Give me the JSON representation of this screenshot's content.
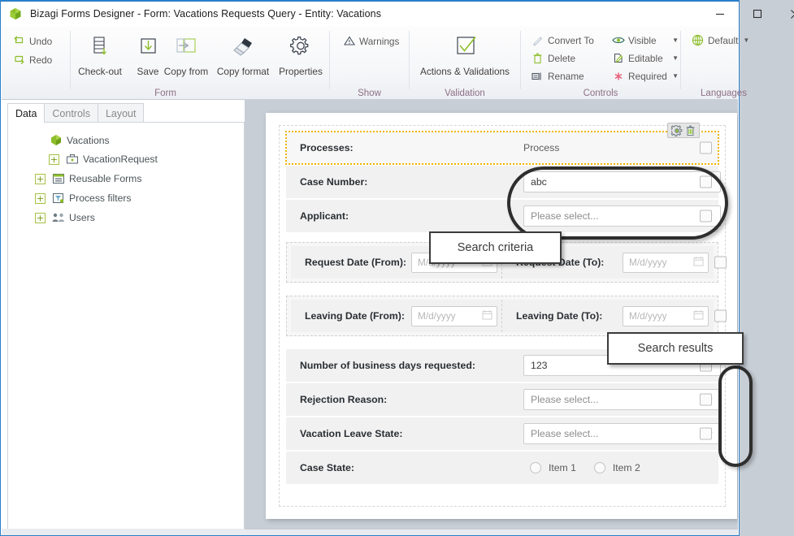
{
  "window": {
    "title": "Bizagi Forms Designer  - Form: Vacations Requests Query - Entity:  Vacations",
    "minimize_label": "Minimize",
    "maximize_label": "Maximize",
    "close_label": "Close",
    "app_icon": "bizagi-cube-icon"
  },
  "ribbon": {
    "groups": [
      {
        "label": "Form"
      },
      {
        "label": "Show"
      },
      {
        "label": "Validation"
      },
      {
        "label": "Controls"
      },
      {
        "label": "Languages"
      }
    ],
    "form": {
      "undo": "Undo",
      "redo": "Redo",
      "check_out": "Check-out",
      "save": "Save",
      "copy_from": "Copy from",
      "copy_format": "Copy format",
      "properties": "Properties"
    },
    "show": {
      "warnings": "Warnings"
    },
    "validation": {
      "actions_validations": "Actions & Validations"
    },
    "controls": {
      "convert_to": "Convert To",
      "delete": "Delete",
      "rename": "Rename",
      "visible": "Visible",
      "editable": "Editable",
      "required": "Required"
    },
    "languages": {
      "default": "Default"
    }
  },
  "left_panel": {
    "tabs": [
      {
        "label": "Data",
        "active": true
      },
      {
        "label": "Controls",
        "active": false
      },
      {
        "label": "Layout",
        "active": false
      }
    ],
    "tree": [
      {
        "label": "Vacations",
        "icon": "cube-icon",
        "expander": false,
        "indent": 0
      },
      {
        "label": "VacationRequest",
        "icon": "entity-icon",
        "expander": true,
        "indent": 1
      },
      {
        "label": "Reusable Forms",
        "icon": "forms-icon",
        "expander": true,
        "indent": 0
      },
      {
        "label": "Process filters",
        "icon": "filter-icon",
        "expander": true,
        "indent": 0
      },
      {
        "label": "Users",
        "icon": "users-icon",
        "expander": true,
        "indent": 0
      }
    ]
  },
  "form": {
    "processes": {
      "label": "Processes:",
      "value": "Process",
      "gear_tool": "configure-icon",
      "delete_tool": "delete-icon"
    },
    "case_number": {
      "label": "Case Number:",
      "value": "abc"
    },
    "applicant": {
      "label": "Applicant:",
      "value": "Please select..."
    },
    "request_date_from": {
      "label": "Request Date (From):",
      "placeholder": "M/d/yyyy"
    },
    "request_date_to": {
      "label": "Request Date (To):",
      "placeholder": "M/d/yyyy"
    },
    "leaving_date_from": {
      "label": "Leaving Date (From):",
      "placeholder": "M/d/yyyy"
    },
    "leaving_date_to": {
      "label": "Leaving Date (To):",
      "placeholder": "M/d/yyyy"
    },
    "business_days": {
      "label": "Number of business days requested:",
      "value": "123"
    },
    "rejection_reason": {
      "label": "Rejection Reason:",
      "value": "Please select..."
    },
    "vacation_leave_state": {
      "label": "Vacation Leave State:",
      "value": "Please select..."
    },
    "case_state": {
      "label": "Case State:",
      "options": [
        "Item 1",
        "Item 2"
      ]
    }
  },
  "annotations": {
    "search_criteria": "Search criteria",
    "search_results": "Search results"
  },
  "colors": {
    "accent": "#2a7fc9",
    "brand_green": "#8cbe2a",
    "group_label": "#8d6f86",
    "selection_dotted": "#f0b400"
  }
}
